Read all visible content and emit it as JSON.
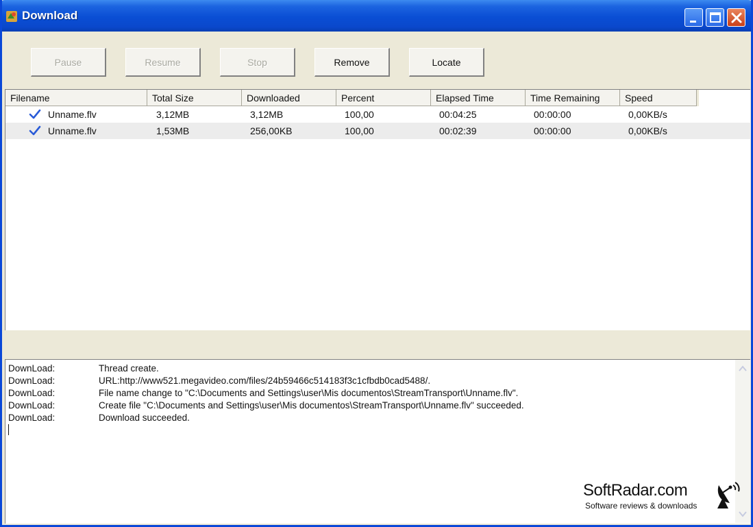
{
  "window": {
    "title": "Download",
    "controls": {
      "minimize": "minimize-icon",
      "maximize": "maximize-icon",
      "close": "close-icon"
    }
  },
  "toolbar": {
    "pause_label": "Pause",
    "resume_label": "Resume",
    "stop_label": "Stop",
    "remove_label": "Remove",
    "locate_label": "Locate"
  },
  "downloads": {
    "columns": [
      "Filename",
      "Total Size",
      "Downloaded",
      "Percent",
      "Elapsed Time",
      "Time Remaining",
      "Speed"
    ],
    "rows": [
      {
        "status_icon": "check-icon",
        "filename": "Unname.flv",
        "total_size": "3,12MB",
        "downloaded": "3,12MB",
        "percent": "100,00",
        "elapsed": "00:04:25",
        "remaining": "00:00:00",
        "speed": "0,00KB/s"
      },
      {
        "status_icon": "check-icon",
        "filename": "Unname.flv",
        "total_size": "1,53MB",
        "downloaded": "256,00KB",
        "percent": "100,00",
        "elapsed": "00:02:39",
        "remaining": "00:00:00",
        "speed": "0,00KB/s"
      }
    ]
  },
  "log": {
    "lines": [
      {
        "source": "DownLoad:",
        "message": "Thread create."
      },
      {
        "source": "DownLoad:",
        "message": "URL:http://www521.megavideo.com/files/24b59466c514183f3c1cfbdb0cad5488/."
      },
      {
        "source": "DownLoad:",
        "message": "File name change to \"C:\\Documents and Settings\\user\\Mis documentos\\StreamTransport\\Unname.flv\"."
      },
      {
        "source": "DownLoad:",
        "message": "Create file \"C:\\Documents and Settings\\user\\Mis documentos\\StreamTransport\\Unname.flv\" succeeded."
      },
      {
        "source": "DownLoad:",
        "message": "Download succeeded."
      }
    ]
  },
  "watermark": {
    "name": "SoftRadar.com",
    "tagline": "Software reviews & downloads",
    "icon": "satellite-dish-icon"
  },
  "colors": {
    "titlebar": "#0a48cc",
    "window_bg": "#ece9d8",
    "close_button": "#c8401a",
    "check": "#2a5bd7"
  }
}
